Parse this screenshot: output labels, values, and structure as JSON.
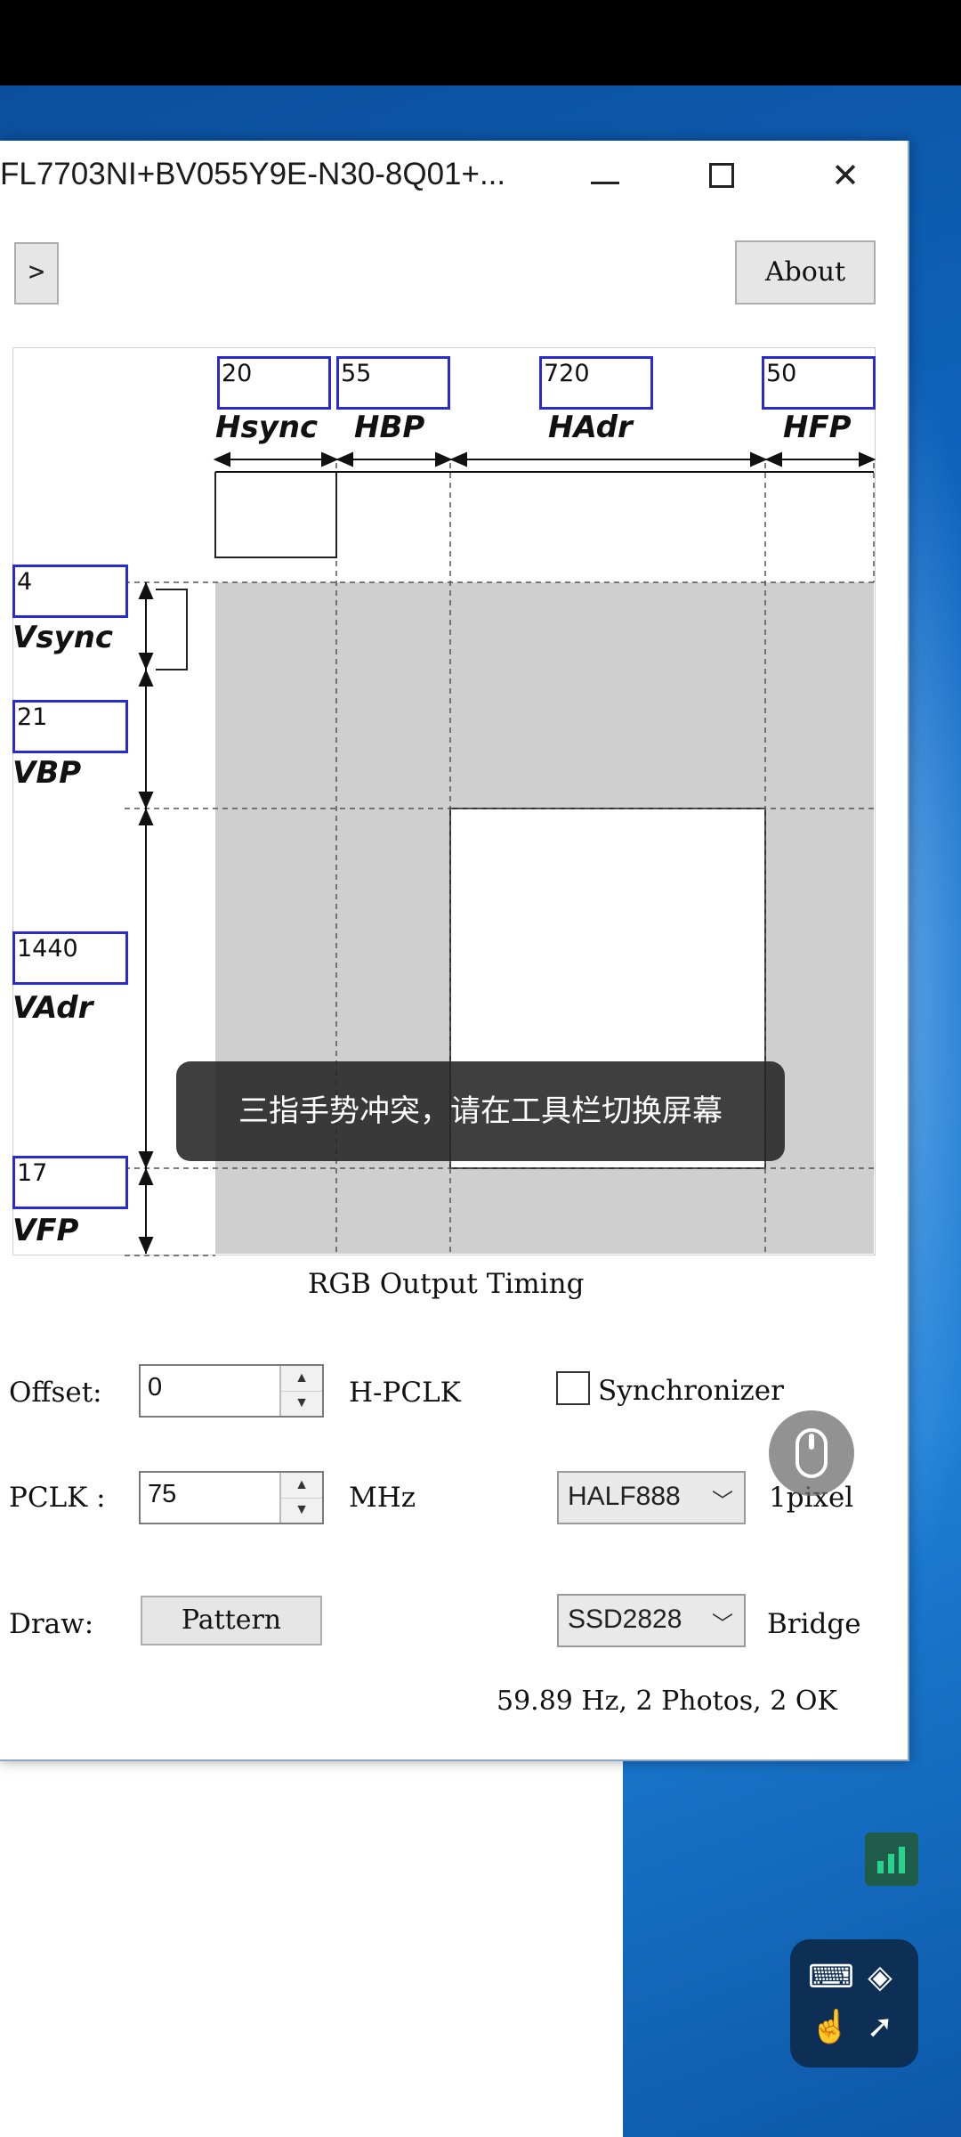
{
  "window": {
    "title": "FL7703NI+BV055Y9E-N30-8Q01+..."
  },
  "buttons": {
    "expand": ">",
    "about": "About",
    "pattern": "Pattern"
  },
  "timing": {
    "h": {
      "hsync": {
        "value": "20",
        "label": "Hsync"
      },
      "hbp": {
        "value": "55",
        "label": "HBP"
      },
      "hadr": {
        "value": "720",
        "label": "HAdr"
      },
      "hfp": {
        "value": "50",
        "label": "HFP"
      }
    },
    "v": {
      "vsync": {
        "value": "4",
        "label": "Vsync"
      },
      "vbp": {
        "value": "21",
        "label": "VBP"
      },
      "vadr": {
        "value": "1440",
        "label": "VAdr"
      },
      "vfp": {
        "value": "17",
        "label": "VFP"
      }
    },
    "caption": "RGB Output Timing"
  },
  "controls": {
    "offset_label": "Offset:",
    "offset_value": "0",
    "offset_unit": "H-PCLK",
    "pclk_label": "PCLK :",
    "pclk_value": "75",
    "pclk_unit": "MHz",
    "draw_label": "Draw:",
    "synchronizer_label": "Synchronizer",
    "synchronizer_checked": false,
    "format_value": "HALF888",
    "format_unit": "1pixel",
    "bridge_value": "SSD2828",
    "bridge_unit": "Bridge"
  },
  "status": "59.89 Hz, 2 Photos, 2 OK",
  "toast": "三指手势冲突，请在工具栏切换屏幕",
  "icons": {
    "mouse": "mouse-icon",
    "signal": "signal-bars-icon",
    "keyboard": "keyboard-icon",
    "layers": "layers-icon",
    "touch": "touch-hand-icon",
    "pointer": "pointer-click-icon"
  }
}
